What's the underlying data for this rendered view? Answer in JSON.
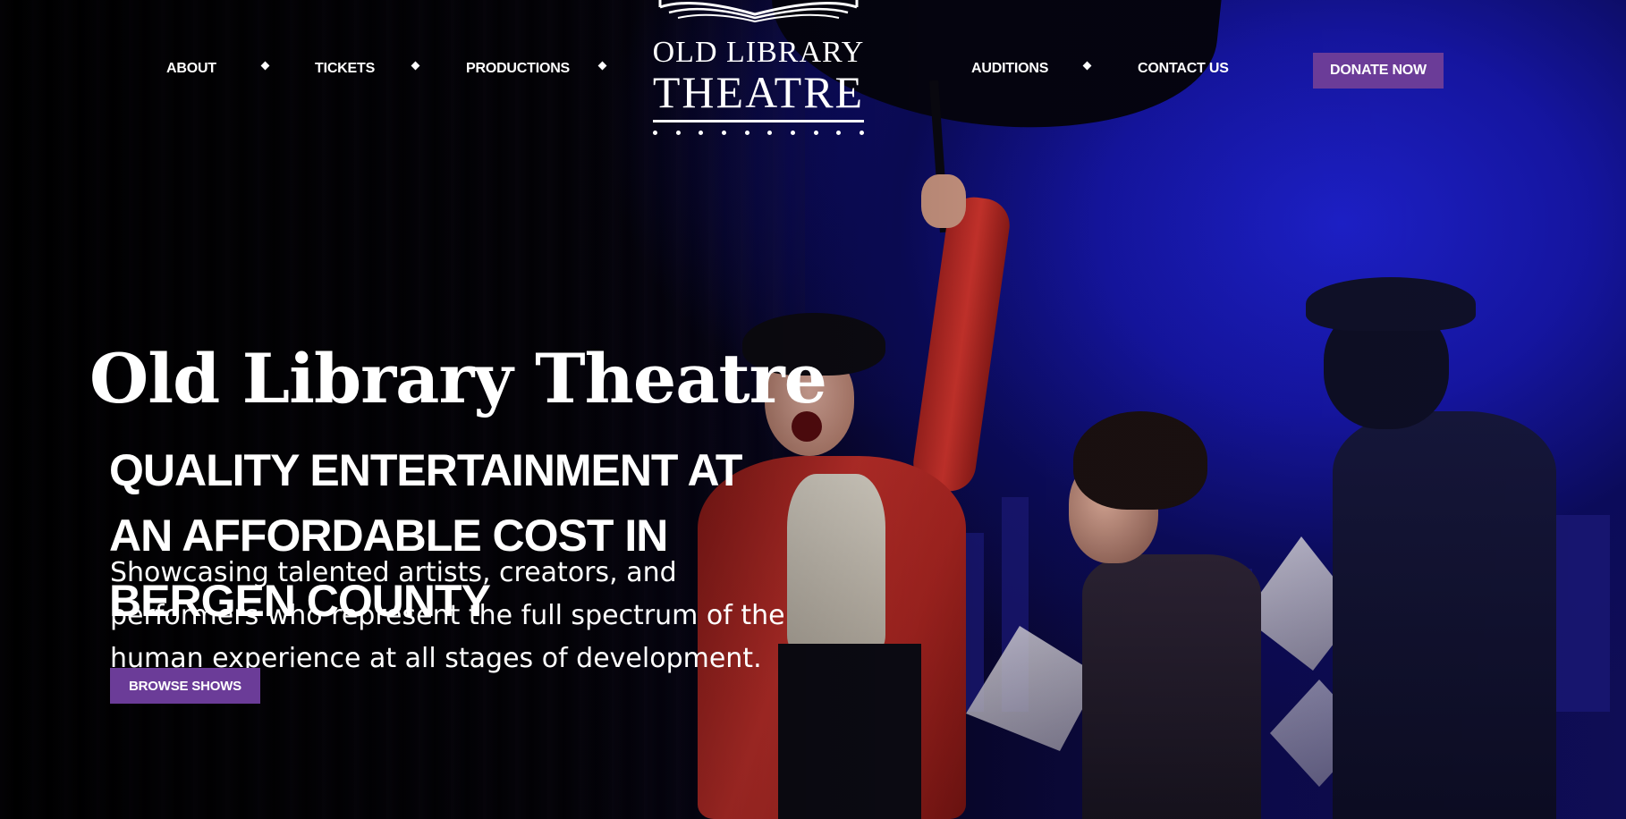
{
  "nav": {
    "left_items": [
      {
        "label": "ABOUT"
      },
      {
        "label": "TICKETS"
      },
      {
        "label": "PRODUCTIONS"
      }
    ],
    "right_items": [
      {
        "label": "AUDITIONS"
      },
      {
        "label": "CONTACT US"
      }
    ],
    "donate_label": "DONATE NOW"
  },
  "logo": {
    "line1": "OLD LIBRARY",
    "line2": "THEATRE",
    "icon": "open-book-icon"
  },
  "hero": {
    "title": "Old Library Theatre",
    "subtitle": "QUALITY ENTERTAINMENT AT AN AFFORDABLE COST IN BERGEN COUNTY",
    "description": "Showcasing talented artists, creators, and performers who represent the full spectrum of the human experience at all stages of development.",
    "cta_label": "BROWSE SHOWS"
  },
  "colors": {
    "accent": "#6b3c98",
    "background_blue": "#1d20c8",
    "text": "#ffffff"
  }
}
